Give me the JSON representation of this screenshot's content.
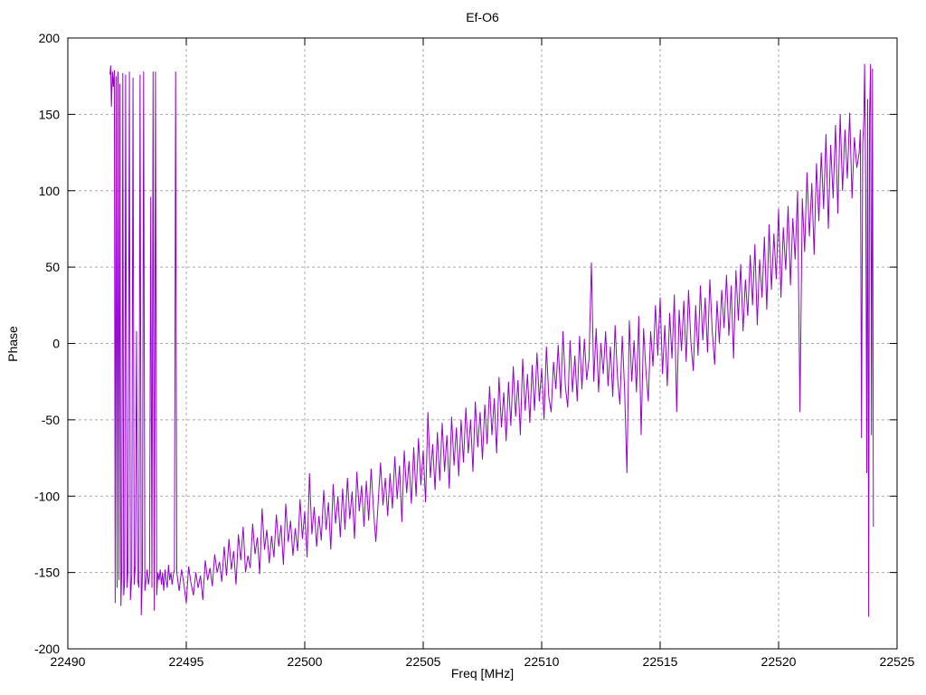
{
  "chart_data": {
    "type": "line",
    "title": "Ef-O6",
    "xlabel": "Freq [MHz]",
    "ylabel": "Phase",
    "xlim": [
      22490,
      22525
    ],
    "ylim": [
      -200,
      200
    ],
    "xticks": [
      22490,
      22495,
      22500,
      22505,
      22510,
      22515,
      22520,
      22525
    ],
    "yticks": [
      -200,
      -150,
      -100,
      -50,
      0,
      50,
      100,
      150,
      200
    ],
    "grid": true,
    "legend": "none",
    "line_color": "#9400d3",
    "grid_color": "#a8a8a8",
    "border_color": "#000000",
    "series": [
      {
        "name": "phase",
        "lead_points": [
          [
            22491.78,
            176
          ],
          [
            22491.81,
            182
          ],
          [
            22491.84,
            155
          ],
          [
            22491.88,
            178
          ],
          [
            22491.92,
            168
          ],
          [
            22491.96,
            179
          ],
          [
            22492.0,
            -170
          ],
          [
            22492.04,
            175
          ],
          [
            22492.08,
            -160
          ],
          [
            22492.12,
            178
          ],
          [
            22492.16,
            -155
          ],
          [
            22492.2,
            170
          ],
          [
            22492.24,
            -172
          ],
          [
            22492.28,
            -148
          ],
          [
            22492.32,
            177
          ],
          [
            22492.36,
            -165
          ],
          [
            22492.4,
            -155
          ],
          [
            22492.44,
            176
          ],
          [
            22492.5,
            -160
          ],
          [
            22492.54,
            -150
          ],
          [
            22492.6,
            178
          ],
          [
            22492.64,
            -168
          ],
          [
            22492.7,
            -152
          ],
          [
            22492.75,
            174
          ],
          [
            22492.8,
            -158
          ],
          [
            22492.85,
            -145
          ],
          [
            22492.9,
            8
          ],
          [
            22492.95,
            -155
          ],
          [
            22493.0,
            -160
          ],
          [
            22493.05,
            176
          ],
          [
            22493.1,
            -178
          ],
          [
            22493.15,
            -150
          ],
          [
            22493.2,
            178
          ],
          [
            22493.25,
            -162
          ],
          [
            22493.3,
            -155
          ],
          [
            22493.35,
            -148
          ],
          [
            22493.4,
            -158
          ],
          [
            22493.45,
            -152
          ],
          [
            22493.5,
            96
          ],
          [
            22493.55,
            -160
          ],
          [
            22493.6,
            178
          ],
          [
            22493.65,
            -175
          ],
          [
            22493.7,
            178
          ],
          [
            22493.75,
            -165
          ],
          [
            22493.8,
            -150
          ],
          [
            22493.85,
            -155
          ],
          [
            22493.9,
            -148
          ],
          [
            22493.95,
            -158
          ],
          [
            22494.0,
            -150
          ],
          [
            22494.05,
            -162
          ],
          [
            22494.1,
            -148
          ],
          [
            22494.15,
            -155
          ],
          [
            22494.2,
            -160
          ],
          [
            22494.25,
            -145
          ],
          [
            22494.3,
            -155
          ],
          [
            22494.35,
            -150
          ],
          [
            22494.4,
            -158
          ],
          [
            22494.45,
            -152
          ],
          [
            22494.5,
            -148
          ],
          [
            22494.55,
            178
          ],
          [
            22494.6,
            -150
          ],
          [
            22494.65,
            -156
          ]
        ],
        "ramp": {
          "x0": 22494.7,
          "dx": 0.1,
          "y": [
            -162,
            -148,
            -158,
            -170,
            -146,
            -157,
            -165,
            -150,
            -160,
            -152,
            -168,
            -142,
            -155,
            -147,
            -159,
            -138,
            -150,
            -143,
            -156,
            -133,
            -152,
            -128,
            -148,
            -136,
            -158,
            -125,
            -142,
            -120,
            -150,
            -139,
            -147,
            -118,
            -138,
            -127,
            -151,
            -108,
            -135,
            -122,
            -144,
            -126,
            -140,
            -112,
            -133,
            -119,
            -145,
            -105,
            -130,
            -116,
            -139,
            -121,
            -136,
            -102,
            -128,
            -110,
            -140,
            -85,
            -125,
            -107,
            -133,
            -113,
            -129,
            -96,
            -122,
            -104,
            -135,
            -92,
            -118,
            -100,
            -127,
            -95,
            -122,
            -88,
            -115,
            -97,
            -128,
            -84,
            -110,
            -93,
            -120,
            -90,
            -116,
            -82,
            -109,
            -130,
            -104,
            -78,
            -106,
            -88,
            -113,
            -85,
            -108,
            -74,
            -102,
            -80,
            -117,
            -70,
            -98,
            -77,
            -105,
            -68,
            -100,
            -62,
            -93,
            -70,
            -104,
            -45,
            -88,
            -66,
            -96,
            -58,
            -90,
            -52,
            -84,
            -60,
            -95,
            -48,
            -80,
            -55,
            -87,
            -50,
            -78,
            -42,
            -72,
            -50,
            -84,
            -38,
            -68,
            -45,
            -76,
            -40,
            -66,
            -28,
            -60,
            -36,
            -72,
            -22,
            -55,
            -32,
            -64,
            -25,
            -54,
            -15,
            -48,
            -24,
            -60,
            -10,
            -44,
            -20,
            -52,
            -14,
            -44,
            -6,
            -38,
            -16,
            -50,
            -2,
            -35,
            -45,
            -12,
            -30,
            -1,
            -36,
            8,
            -28,
            -42,
            2,
            -32,
            -8,
            -38,
            5,
            -30,
            3,
            -24,
            -10,
            53,
            -25,
            10,
            -32,
            0,
            -20,
            8,
            -28,
            -2,
            -35,
            12,
            -22,
            -40,
            5,
            -30,
            -85,
            15,
            -25,
            2,
            -32,
            18,
            -60,
            10,
            -18,
            -38,
            8,
            -15,
            25,
            -8,
            30,
            -20,
            12,
            -28,
            20,
            -10,
            32,
            -45,
            22,
            -5,
            28,
            -12,
            35,
            0,
            -18,
            25,
            -8,
            38,
            2,
            30,
            -6,
            42,
            8,
            -14,
            28,
            0,
            35,
            10,
            45,
            5,
            38,
            -10,
            48,
            15,
            52,
            8,
            42,
            18,
            58,
            25,
            65,
            12,
            55,
            30,
            70,
            22,
            78,
            35,
            72,
            42,
            88,
            30,
            76,
            48,
            90,
            38,
            82,
            55,
            100,
            -45,
            95,
            60,
            112,
            70,
            105,
            58,
            118,
            80,
            125,
            88,
            137,
            75,
            130,
            95,
            143,
            85,
            150,
            100,
            140,
            108,
            151,
            95,
            135,
            115,
            125
          ]
        },
        "tail_points": [
          [
            22523.45,
            140
          ],
          [
            22523.5,
            -62
          ],
          [
            22523.55,
            130
          ],
          [
            22523.6,
            148
          ],
          [
            22523.63,
            183
          ],
          [
            22523.68,
            100
          ],
          [
            22523.72,
            -85
          ],
          [
            22523.76,
            160
          ],
          [
            22523.8,
            -179
          ],
          [
            22523.84,
            150
          ],
          [
            22523.88,
            183
          ],
          [
            22523.92,
            -60
          ],
          [
            22523.96,
            180
          ],
          [
            22524.0,
            -120
          ]
        ]
      }
    ]
  }
}
